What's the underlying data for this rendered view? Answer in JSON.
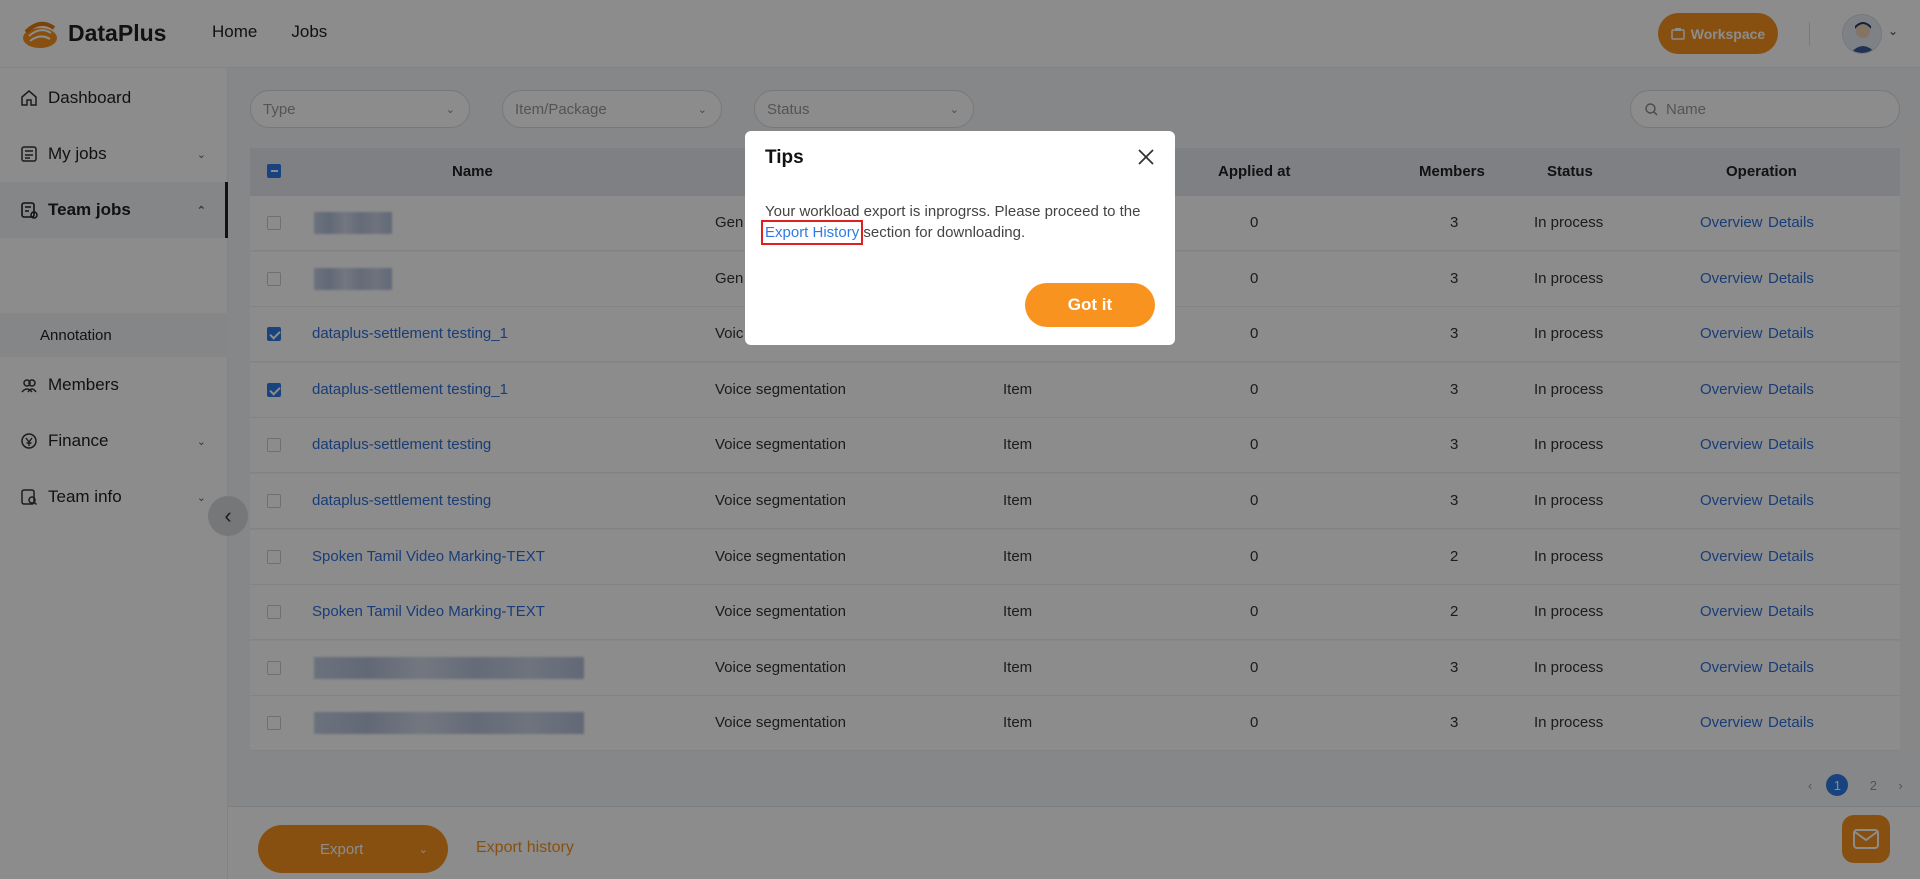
{
  "app": {
    "name": "DataPlus"
  },
  "nav": {
    "items": [
      "Home",
      "Jobs"
    ]
  },
  "header": {
    "workspace_label": "Workspace",
    "accent": "#f7931e"
  },
  "sidebar": {
    "items": [
      {
        "label": "Dashboard",
        "icon": "home-icon"
      },
      {
        "label": "My jobs",
        "icon": "jobs-icon"
      },
      {
        "label": "Team jobs",
        "icon": "team-jobs-icon"
      },
      {
        "label": "Members",
        "icon": "members-icon"
      },
      {
        "label": "Finance",
        "icon": "finance-icon"
      },
      {
        "label": "Team info",
        "icon": "team-info-icon"
      }
    ],
    "sub_item": "Annotation"
  },
  "filters": {
    "type_placeholder": "Type",
    "item_package_placeholder": "Item/Package",
    "status_placeholder": "Status",
    "search_placeholder": "Name"
  },
  "table": {
    "headers": {
      "name": "Name",
      "applied_at": "Applied at",
      "members": "Members",
      "status": "Status",
      "operation": "Operation"
    },
    "overview_label": "Overview",
    "details_label": "Details",
    "rows": [
      {
        "name": "",
        "type": "Gen",
        "item": "",
        "applied": "0",
        "members": "3",
        "status": "In process",
        "checked": false
      },
      {
        "name": "",
        "type": "Gen",
        "item": "",
        "applied": "0",
        "members": "3",
        "status": "In process",
        "checked": false
      },
      {
        "name": "dataplus-settlement testing_1",
        "type": "Voic",
        "item": "",
        "applied": "0",
        "members": "3",
        "status": "In process",
        "checked": true
      },
      {
        "name": "dataplus-settlement testing_1",
        "type": "Voice segmentation",
        "item": "Item",
        "applied": "0",
        "members": "3",
        "status": "In process",
        "checked": true
      },
      {
        "name": "dataplus-settlement testing",
        "type": "Voice segmentation",
        "item": "Item",
        "applied": "0",
        "members": "3",
        "status": "In process",
        "checked": false
      },
      {
        "name": "dataplus-settlement testing",
        "type": "Voice segmentation",
        "item": "Item",
        "applied": "0",
        "members": "3",
        "status": "In process",
        "checked": false
      },
      {
        "name": "Spoken Tamil Video Marking-TEXT",
        "type": "Voice segmentation",
        "item": "Item",
        "applied": "0",
        "members": "2",
        "status": "In process",
        "checked": false
      },
      {
        "name": "Spoken Tamil Video Marking-TEXT",
        "type": "Voice segmentation",
        "item": "Item",
        "applied": "0",
        "members": "2",
        "status": "In process",
        "checked": false
      },
      {
        "name": "",
        "type": "Voice segmentation",
        "item": "Item",
        "applied": "0",
        "members": "3",
        "status": "In process",
        "checked": false
      },
      {
        "name": "",
        "type": "Voice segmentation",
        "item": "Item",
        "applied": "0",
        "members": "3",
        "status": "In process",
        "checked": false
      }
    ]
  },
  "pagination": {
    "pages": [
      "1",
      "2"
    ],
    "current": "1"
  },
  "footer": {
    "export_label": "Export",
    "export_history_label": "Export history"
  },
  "modal": {
    "title": "Tips",
    "body_before": "Your workload export is inprogrss. Please proceed to the ",
    "link_text": "Export History",
    "body_after": " section for downloading.",
    "button_label": "Got it"
  }
}
